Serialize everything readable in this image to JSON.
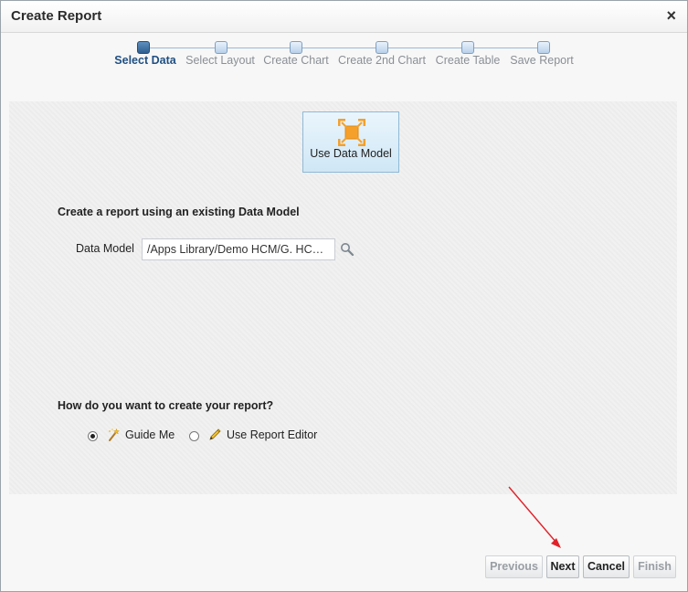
{
  "dialog": {
    "title": "Create Report",
    "close_glyph": "×"
  },
  "train": {
    "steps": [
      {
        "label": "Select Data",
        "active": true
      },
      {
        "label": "Select Layout",
        "active": false
      },
      {
        "label": "Create Chart",
        "active": false
      },
      {
        "label": "Create 2nd Chart",
        "active": false
      },
      {
        "label": "Create Table",
        "active": false
      },
      {
        "label": "Save Report",
        "active": false
      }
    ]
  },
  "source": {
    "button_label": "Use Data Model",
    "icon": "data-model-icon",
    "heading": "Create a report using an existing Data Model",
    "field_label": "Data Model",
    "field_value": "/Apps Library/Demo HCM/G. HCM Model",
    "search_icon": "search-icon"
  },
  "creation": {
    "heading": "How do you want to create your report?",
    "options": [
      {
        "label": "Guide Me",
        "checked": true,
        "icon": "wand-icon"
      },
      {
        "label": "Use Report Editor",
        "checked": false,
        "icon": "pencil-icon"
      }
    ]
  },
  "footer": {
    "previous": "Previous",
    "next": "Next",
    "cancel": "Cancel",
    "finish": "Finish",
    "previous_disabled": true,
    "finish_disabled": true
  },
  "colors": {
    "active_step": "#1f4f82",
    "inactive_step": "#8a8f95",
    "accent_orange": "#f5a02a",
    "annotation_arrow": "#e0222a"
  }
}
